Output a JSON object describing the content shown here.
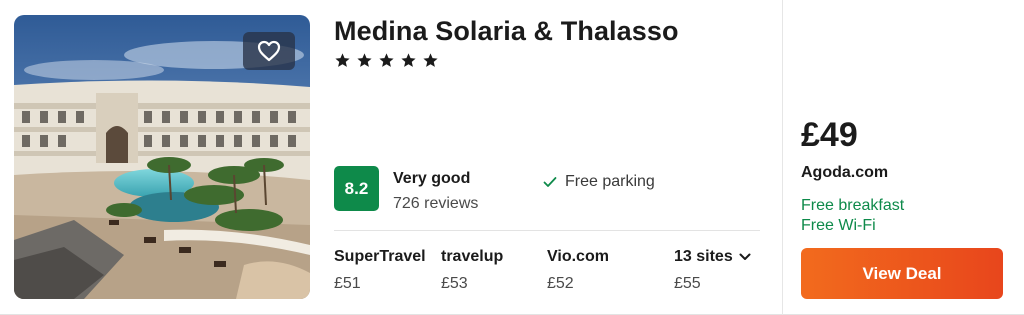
{
  "hotel": {
    "name": "Medina Solaria & Thalasso",
    "star_rating": 5
  },
  "rating": {
    "score": "8.2",
    "label": "Very good",
    "reviews": "726 reviews",
    "badge_color": "#0e8a4a"
  },
  "amenities": [
    {
      "icon": "check-icon",
      "label": "Free parking"
    }
  ],
  "offers": [
    {
      "provider": "SuperTravel",
      "price": "£51"
    },
    {
      "provider": "travelup",
      "price": "£53"
    },
    {
      "provider": "Vio.com",
      "price": "£52"
    },
    {
      "provider": "13 sites",
      "price": "£55",
      "icon": "chevron-down-icon"
    }
  ],
  "deal": {
    "price": "£49",
    "provider": "Agoda.com",
    "perks": [
      "Free breakfast",
      "Free Wi-Fi"
    ],
    "button_label": "View Deal",
    "button_color": "#f0591d",
    "perk_color": "#0e8a4a"
  },
  "icons": {
    "favorite": "heart-icon",
    "star": "star-icon"
  }
}
